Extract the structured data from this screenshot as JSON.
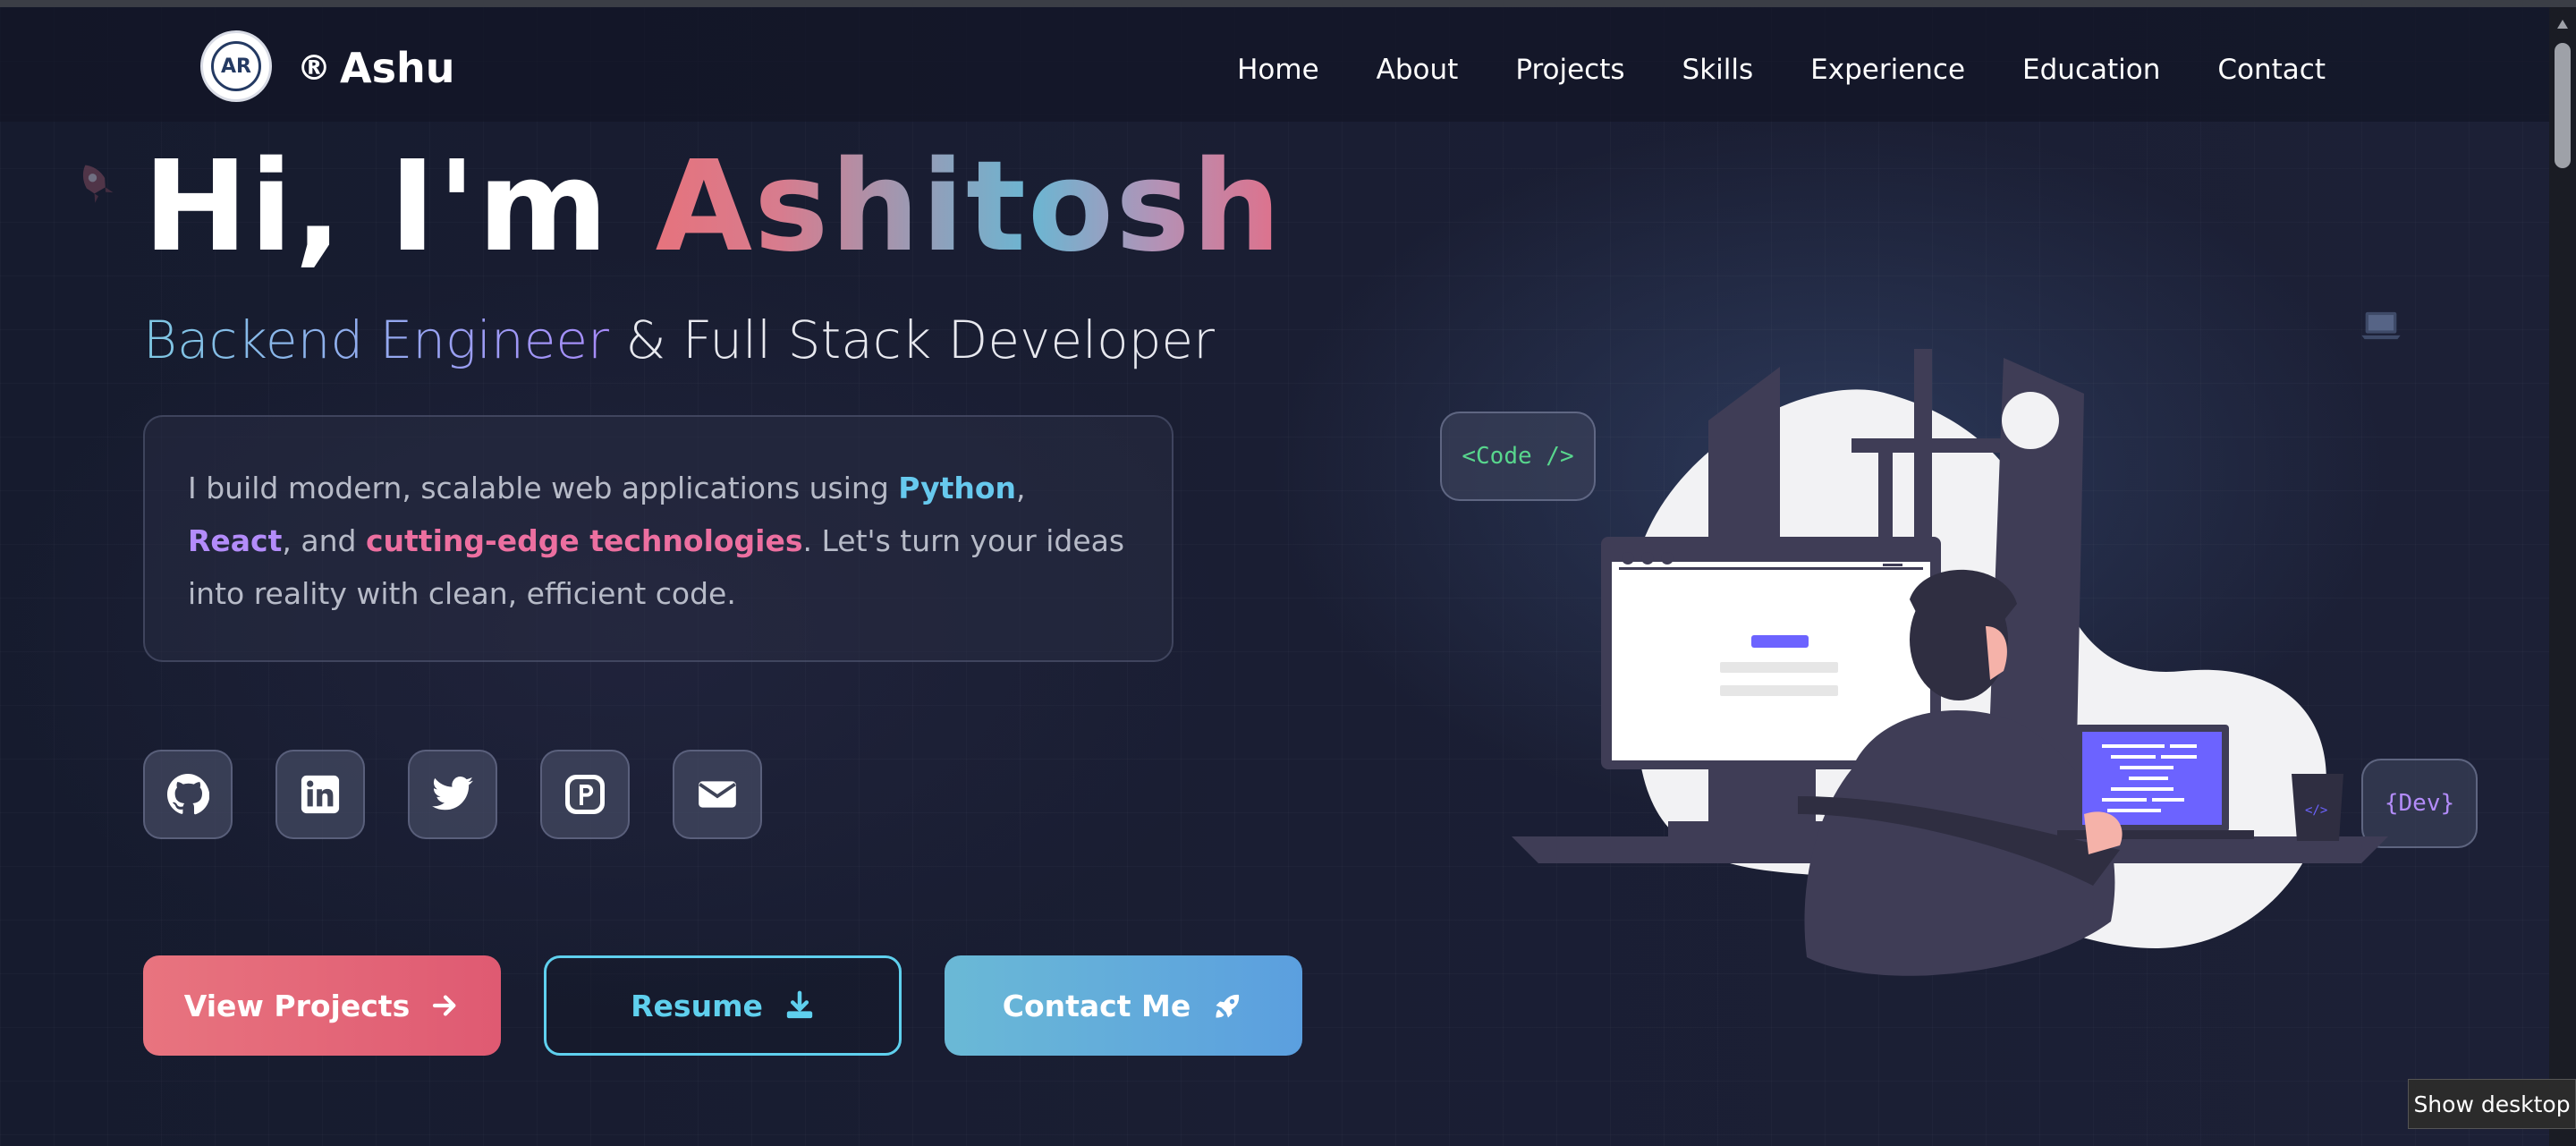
{
  "brand": {
    "logo_text": "AR",
    "name": "Ashu",
    "registered_mark": "®"
  },
  "nav": {
    "items": [
      "Home",
      "About",
      "Projects",
      "Skills",
      "Experience",
      "Education",
      "Contact"
    ]
  },
  "hero": {
    "greeting": "Hi, I'm ",
    "name": "Ashitosh",
    "subtitle_accent": "Backend Engineer",
    "subtitle_rest": " & Full Stack Developer",
    "desc": {
      "p1": "I build modern, scalable web applications using ",
      "python": "Python",
      "comma": ", ",
      "react": "React",
      "p2": ", and ",
      "cutting": "cutting-edge technologies",
      "p3": ". Let's turn your ideas into reality with clean, efficient code."
    }
  },
  "socials": [
    {
      "name": "github-icon"
    },
    {
      "name": "linkedin-icon"
    },
    {
      "name": "twitter-icon"
    },
    {
      "name": "producthunt-icon"
    },
    {
      "name": "email-icon"
    }
  ],
  "buttons": {
    "projects": "View Projects",
    "resume": "Resume",
    "contact": "Contact Me"
  },
  "chips": {
    "code": "<Code />",
    "dev": "{Dev}"
  },
  "illustration": {
    "laptop_tag": "</>"
  },
  "tooltip": "Show desktop",
  "colors": {
    "accent_red": "#e8747f",
    "accent_cyan": "#5fd0ee",
    "accent_blue": "#5b9fdf",
    "python": "#67c9ee",
    "react": "#b38cfa",
    "cutting_edge": "#ec6fa0"
  }
}
